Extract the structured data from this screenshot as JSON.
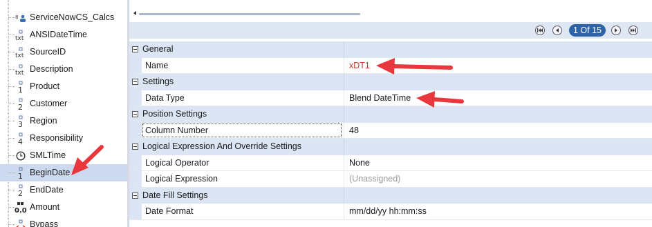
{
  "tree": {
    "items": [
      {
        "label": "ServiceNowCS_Calcs",
        "icon": "dataset-icon",
        "type_glyph": "⭘"
      },
      {
        "label": "ANSIDateTime",
        "icon": "text-type-icon",
        "type_glyph": "txt"
      },
      {
        "label": "SourceID",
        "icon": "text-type-icon",
        "type_glyph": "txt"
      },
      {
        "label": "Description",
        "icon": "text-type-icon",
        "type_glyph": "txt"
      },
      {
        "label": "Product",
        "icon": "dimension-1-icon",
        "type_glyph": "1"
      },
      {
        "label": "Customer",
        "icon": "dimension-2-icon",
        "type_glyph": "2"
      },
      {
        "label": "Region",
        "icon": "dimension-3-icon",
        "type_glyph": "3"
      },
      {
        "label": "Responsibility",
        "icon": "dimension-4-icon",
        "type_glyph": "4"
      },
      {
        "label": "SMLTime",
        "icon": "clock-icon",
        "type_glyph": "⏲"
      },
      {
        "label": "BeginDate",
        "icon": "dimension-1-icon",
        "type_glyph": "1",
        "selected": true
      },
      {
        "label": "EndDate",
        "icon": "dimension-2-icon",
        "type_glyph": "2"
      },
      {
        "label": "Amount",
        "icon": "measure-icon",
        "type_glyph": "0.0"
      },
      {
        "label": "Bypass",
        "icon": "code-icon",
        "type_glyph": "<>"
      }
    ]
  },
  "pager": {
    "label": "1 Of 15"
  },
  "properties": {
    "sections": [
      {
        "title": "General",
        "rows": [
          {
            "name": "Name",
            "value": "xDT1",
            "style": "red"
          }
        ]
      },
      {
        "title": "Settings",
        "rows": [
          {
            "name": "Data Type",
            "value": "Blend DateTime",
            "style": "normal"
          }
        ]
      },
      {
        "title": "Position Settings",
        "rows": [
          {
            "name": "Column Number",
            "value": "48",
            "style": "normal",
            "focused": true
          }
        ]
      },
      {
        "title": "Logical Expression And Override Settings",
        "rows": [
          {
            "name": "Logical Operator",
            "value": "None",
            "style": "normal"
          },
          {
            "name": "Logical Expression",
            "value": "(Unassigned)",
            "style": "gray"
          }
        ]
      },
      {
        "title": "Date Fill Settings",
        "rows": [
          {
            "name": "Date Format",
            "value": "mm/dd/yy hh:mm:ss",
            "style": "normal"
          }
        ]
      }
    ]
  },
  "colors": {
    "accent": "#2e63a8",
    "section_bg": "#dbe5f4",
    "selection_bg": "#cdd9ee",
    "annotation_arrow": "#e8383d"
  }
}
